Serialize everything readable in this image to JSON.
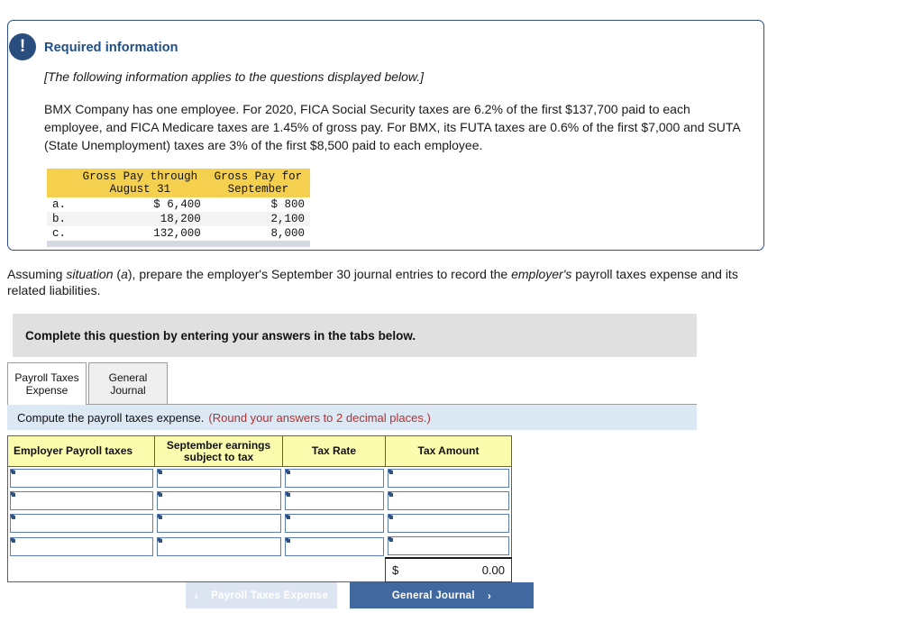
{
  "required_box": {
    "alert_icon": "exclamation-icon",
    "title": "Required information",
    "italic_note": "[The following information applies to the questions displayed below.]",
    "body": "BMX Company has one employee. For 2020, FICA Social Security taxes are 6.2% of the first $137,700 paid to each employee, and FICA Medicare taxes are 1.45% of gross pay. For BMX, its FUTA taxes are 0.6% of the first $7,000 and SUTA (State Unemployment) taxes are 3% of the first $8,500 paid to each employee.",
    "gross_table": {
      "headers": [
        "",
        "Gross Pay through\nAugust 31",
        "Gross Pay for\nSeptember"
      ],
      "rows": [
        {
          "label": "a.",
          "through_aug": "$  6,400",
          "september": "$   800"
        },
        {
          "label": "b.",
          "through_aug": "18,200",
          "september": "2,100"
        },
        {
          "label": "c.",
          "through_aug": "132,000",
          "september": "8,000"
        }
      ]
    }
  },
  "assumption": {
    "text_parts": {
      "p1": "Assuming ",
      "i1": "situation",
      "p2": " (",
      "i2": "a",
      "p3": "), prepare the employer's September 30 journal entries to record the ",
      "i3": "employer's",
      "p4": " payroll taxes expense and its related liabilities."
    }
  },
  "complete_bar": {
    "text": "Complete this question by entering your answers in the tabs below."
  },
  "tabs": [
    {
      "label": "Payroll Taxes\nExpense",
      "active": true
    },
    {
      "label": "General\nJournal",
      "active": false
    }
  ],
  "instruction": {
    "text": "Compute the payroll taxes expense.",
    "hint": "(Round your answers to 2 decimal places.)"
  },
  "answer_table": {
    "headers": [
      "Employer Payroll taxes",
      "September earnings\nsubject to tax",
      "Tax Rate",
      "Tax Amount"
    ],
    "rows": [
      {
        "payroll_tax": "",
        "earnings": "",
        "rate": "",
        "amount": ""
      },
      {
        "payroll_tax": "",
        "earnings": "",
        "rate": "",
        "amount": ""
      },
      {
        "payroll_tax": "",
        "earnings": "",
        "rate": "",
        "amount": ""
      },
      {
        "payroll_tax": "",
        "earnings": "",
        "rate": "",
        "amount": ""
      }
    ],
    "total": {
      "currency": "$",
      "value": "0.00"
    }
  },
  "footer": {
    "prev_button": {
      "label": "Payroll Taxes Expense",
      "icon": "chevron-left-icon",
      "chevron": "‹",
      "enabled": false
    },
    "next_button": {
      "label": "General Journal",
      "icon": "chevron-right-icon",
      "chevron": "›",
      "enabled": true
    }
  },
  "colors": {
    "box_border": "#2d4f8b",
    "badge": "#2a4d80",
    "title": "#1f4e87",
    "gross_header_yellow": "#f5d04e",
    "answer_header_yellow": "#fcfcaf",
    "instruction_blue": "#dde8f5",
    "complete_grey": "#e0e0e0",
    "hint_red": "#b03030",
    "next_blue": "#41699f",
    "prev_blue": "#dce5f1",
    "input_border": "#5b7fb4"
  }
}
